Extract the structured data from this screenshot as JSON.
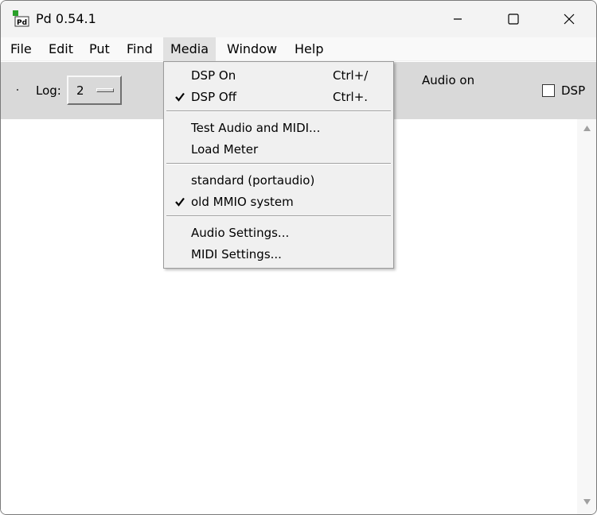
{
  "window": {
    "title": "Pd 0.54.1",
    "controls": {
      "minimize": "minimize-icon",
      "maximize": "maximize-icon",
      "close": "close-icon"
    }
  },
  "menubar": {
    "items": [
      {
        "label": "File"
      },
      {
        "label": "Edit"
      },
      {
        "label": "Put"
      },
      {
        "label": "Find"
      },
      {
        "label": "Media"
      },
      {
        "label": "Window"
      },
      {
        "label": "Help"
      }
    ],
    "active": "Media"
  },
  "toolbar": {
    "log_label": "Log:",
    "log_value": "2",
    "audio_status": "Audio on",
    "dsp_label": "DSP",
    "dsp_checked": false
  },
  "media_menu": {
    "items": [
      {
        "label": "DSP On",
        "shortcut": "Ctrl+/",
        "checked": false
      },
      {
        "label": "DSP Off",
        "shortcut": "Ctrl+.",
        "checked": true
      },
      {
        "label": "Test Audio and MIDI...",
        "shortcut": "",
        "checked": false
      },
      {
        "label": "Load Meter",
        "shortcut": "",
        "checked": false
      },
      {
        "label": "standard (portaudio)",
        "shortcut": "",
        "checked": false
      },
      {
        "label": "old MMIO system",
        "shortcut": "",
        "checked": true
      },
      {
        "label": "Audio Settings...",
        "shortcut": "",
        "checked": false
      },
      {
        "label": "MIDI Settings...",
        "shortcut": "",
        "checked": false
      }
    ]
  },
  "colors": {
    "toolbar_bg": "#d9d9d9",
    "menu_bg": "#f0f0f0",
    "active_menu_bg": "#e1e1e1",
    "title_bar_bg": "#f3f3f3"
  }
}
